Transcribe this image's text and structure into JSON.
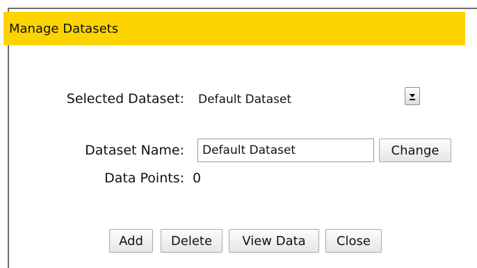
{
  "dialog": {
    "title": "Manage Datasets"
  },
  "selected_dataset": {
    "label": "Selected Dataset:",
    "value": "Default Dataset"
  },
  "dataset_name": {
    "label": "Dataset Name:",
    "value": "Default Dataset"
  },
  "data_points": {
    "label": "Data Points:",
    "value": "0"
  },
  "buttons": {
    "change": "Change",
    "add": "Add",
    "delete": "Delete",
    "view_data": "View Data",
    "close": "Close"
  },
  "colors": {
    "title_bar": "#fdd400"
  }
}
